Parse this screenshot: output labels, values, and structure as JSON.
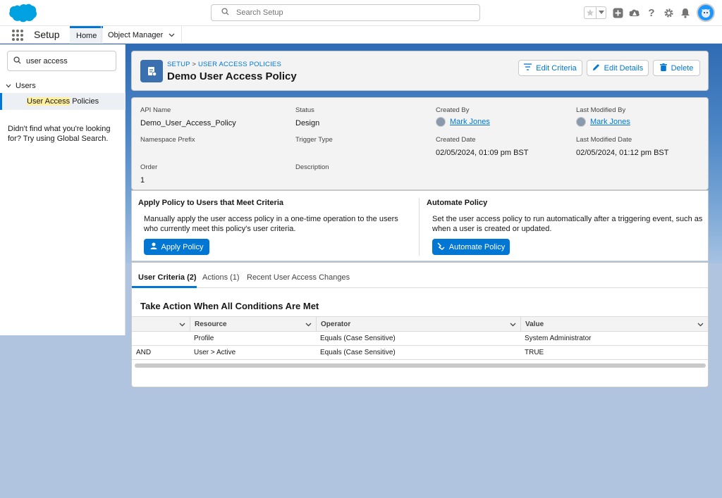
{
  "header": {
    "search_placeholder": "Search Setup",
    "icons": [
      "favorites-star-icon",
      "favorites-list-icon",
      "global-actions-icon",
      "trailhead-icon",
      "help-icon",
      "setup-gear-icon",
      "notifications-bell-icon",
      "user-avatar"
    ]
  },
  "nav": {
    "app_name": "Setup",
    "tabs": [
      {
        "label": "Home"
      },
      {
        "label": "Object Manager"
      }
    ]
  },
  "sidebar": {
    "quickfind_value": "user access",
    "tree": {
      "parent": "Users",
      "child_highlight": "User Access",
      "child_rest": " Policies"
    },
    "not_found_text": "Didn't find what you're looking for? Try using Global Search."
  },
  "record": {
    "breadcrumb_root": "SETUP",
    "breadcrumb_sep": ">",
    "breadcrumb_object": "USER ACCESS POLICIES",
    "title": "Demo User Access Policy",
    "buttons": {
      "edit_criteria": "Edit Criteria",
      "edit_details": "Edit Details",
      "delete": "Delete"
    }
  },
  "details": {
    "api_name_label": "API Name",
    "api_name_value": "Demo_User_Access_Policy",
    "status_label": "Status",
    "status_value": "Design",
    "created_by_label": "Created By",
    "created_by_value": "Mark Jones",
    "last_modified_by_label": "Last Modified By",
    "last_modified_by_value": "Mark Jones",
    "namespace_label": "Namespace Prefix",
    "trigger_label": "Trigger Type",
    "created_date_label": "Created Date",
    "created_date_value": "02/05/2024, 01:09 pm BST",
    "last_modified_date_label": "Last Modified Date",
    "last_modified_date_value": "02/05/2024, 01:12 pm BST",
    "order_label": "Order",
    "order_value": "1",
    "description_label": "Description"
  },
  "actions": {
    "apply": {
      "title": "Apply Policy to Users that Meet Criteria",
      "text": "Manually apply the user access policy in a one-time operation to the users who currently meet this policy's user criteria.",
      "button": "Apply Policy"
    },
    "automate": {
      "title": "Automate Policy",
      "text": "Set the user access policy to run automatically after a triggering event, such as when a user is created or updated.",
      "button": "Automate Policy"
    }
  },
  "tabs": [
    {
      "label": "User Criteria (2)"
    },
    {
      "label": "Actions (1)"
    },
    {
      "label": "Recent User Access Changes"
    }
  ],
  "criteria": {
    "title": "Take Action When All Conditions Are Met",
    "columns": [
      "",
      "Resource",
      "Operator",
      "Value"
    ],
    "rows": [
      [
        "",
        "Profile",
        "Equals (Case Sensitive)",
        "System Administrator"
      ],
      [
        "AND",
        "User > Active",
        "Equals (Case Sensitive)",
        "TRUE"
      ]
    ]
  },
  "colors": {
    "brand": "#0176d3",
    "logo": "#00a1e0"
  }
}
